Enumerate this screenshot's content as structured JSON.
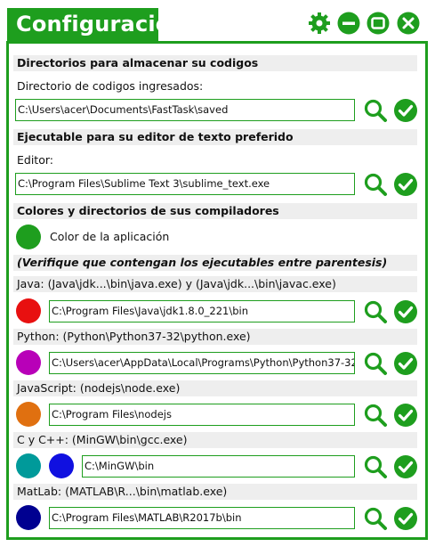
{
  "window": {
    "title": "Configuración",
    "colors": {
      "accent": "#1e9e1e"
    }
  },
  "sections": {
    "directories_header": "Directorios para almacenar su codigos",
    "saved_dir_label": "Directorio de codigos ingresados:",
    "saved_dir_value": "C:\\Users\\acer\\Documents\\FastTask\\saved",
    "editor_header": "Ejecutable para su editor de texto preferido",
    "editor_label": "Editor:",
    "editor_value": "C:\\Program Files\\Sublime Text 3\\sublime_text.exe",
    "compilers_header": "Colores y directorios de sus compiladores",
    "app_color_label": "Color de la aplicación",
    "verify_note": "(Verifique que contengan los ejecutables entre parentesis)"
  },
  "compilers": {
    "java": {
      "label": "Java: (Java\\jdk...\\bin\\java.exe) y (Java\\jdk...\\bin\\javac.exe)",
      "value": "C:\\Program Files\\Java\\jdk1.8.0_221\\bin",
      "color": "#e81010"
    },
    "python": {
      "label": "Python: (Python\\Python37-32\\python.exe)",
      "value": "C:\\Users\\acer\\AppData\\Local\\Programs\\Python\\Python37-32",
      "color": "#b800b8"
    },
    "javascript": {
      "label": "JavaScript: (nodejs\\node.exe)",
      "value": "C:\\Program Files\\nodejs",
      "color": "#e07010"
    },
    "cpp": {
      "label": "C y C++: (MinGW\\bin\\gcc.exe)",
      "value": "C:\\MinGW\\bin",
      "color_c": "#009a9a",
      "color_cpp": "#1010e0"
    },
    "matlab": {
      "label": "MatLab: (MATLAB\\R...\\bin\\matlab.exe)",
      "value": "C:\\Program Files\\MATLAB\\R2017b\\bin",
      "color": "#000090"
    }
  },
  "icons": {
    "settings": "gear-icon",
    "minimize": "minimize-icon",
    "maximize": "maximize-icon",
    "close": "close-icon",
    "browse": "search-icon",
    "confirm": "check-icon"
  },
  "app_color": "#1e9e1e"
}
